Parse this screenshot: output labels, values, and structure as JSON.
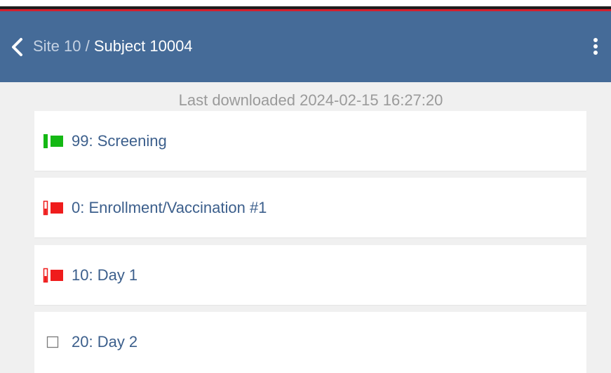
{
  "colors": {
    "header_bg": "#456b98",
    "page_bg": "#f0f0f0",
    "link_text": "#3c5f8c",
    "status_complete": "#14b814",
    "status_incomplete": "#ef1c1c"
  },
  "header": {
    "back_icon": "chevron-left-icon",
    "breadcrumb": {
      "site": "Site 10",
      "separator": "/",
      "subject": "Subject 10004"
    },
    "menu_icon": "more-vertical-icon"
  },
  "status_text": "Last downloaded 2024-02-15 16:27:20",
  "visits": [
    {
      "label": "99: Screening",
      "status": "complete"
    },
    {
      "label": "0: Enrollment/Vaccination #1",
      "status": "incomplete"
    },
    {
      "label": "10: Day 1",
      "status": "incomplete"
    },
    {
      "label": "20: Day 2",
      "status": "not-started"
    }
  ]
}
